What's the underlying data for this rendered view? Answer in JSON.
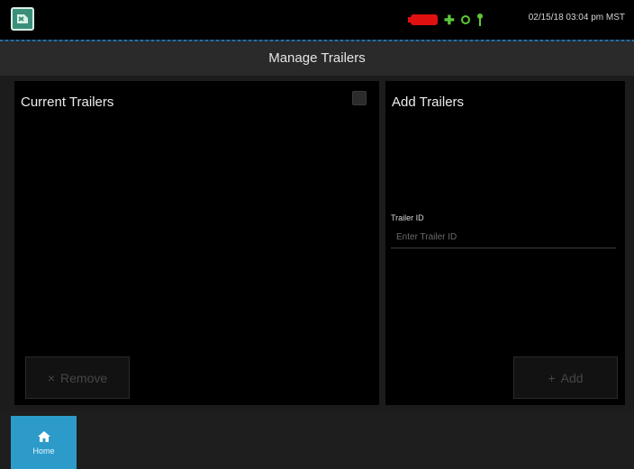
{
  "status_bar": {
    "datetime": "02/15/18 03:04 pm MST",
    "icons": [
      "app-logo-icon",
      "battery-icon",
      "plus-icon",
      "gps-icon",
      "pin-icon"
    ],
    "colors": {
      "battery": "#e01010",
      "indicators": "#5ec83a"
    }
  },
  "header": {
    "title": "Manage Trailers"
  },
  "current_trailers": {
    "title": "Current Trailers",
    "remove_button": {
      "icon": "×",
      "label": "Remove"
    }
  },
  "add_trailers": {
    "title": "Add Trailers",
    "trailer_id": {
      "label": "Trailer ID",
      "placeholder": "Enter Trailer ID",
      "value": ""
    },
    "add_button": {
      "icon": "+",
      "label": "Add"
    }
  },
  "nav": {
    "home": {
      "label": "Home",
      "icon": "home-icon",
      "color": "#2d9bc9"
    }
  }
}
